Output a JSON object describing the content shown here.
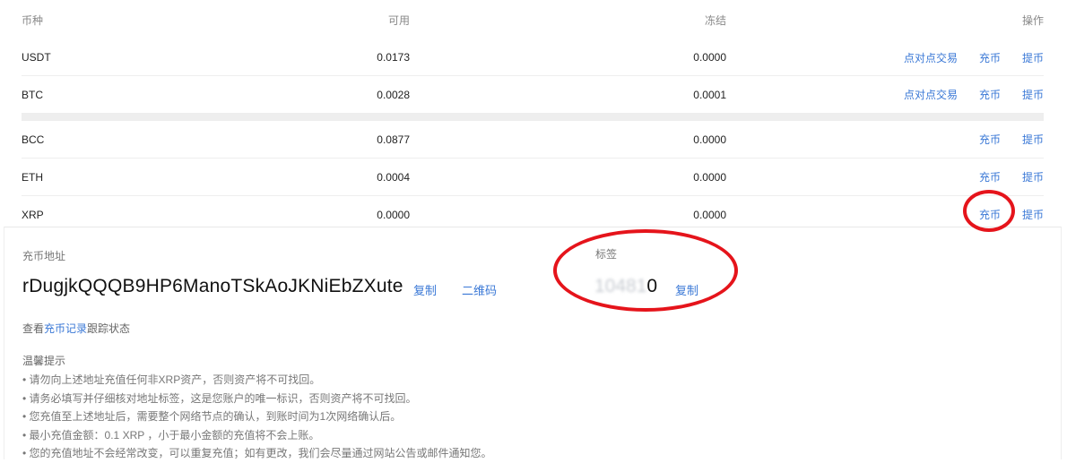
{
  "table": {
    "headers": {
      "currency": "币种",
      "available": "可用",
      "frozen": "冻结",
      "actions": "操作"
    },
    "rows": [
      {
        "currency": "USDT",
        "available": "0.0173",
        "frozen": "0.0000",
        "p2p": "点对点交易",
        "deposit": "充币",
        "withdraw": "提币"
      },
      {
        "currency": "BTC",
        "available": "0.0028",
        "frozen": "0.0001",
        "p2p": "点对点交易",
        "deposit": "充币",
        "withdraw": "提币"
      },
      {
        "currency": "BCC",
        "available": "0.0877",
        "frozen": "0.0000",
        "deposit": "充币",
        "withdraw": "提币"
      },
      {
        "currency": "ETH",
        "available": "0.0004",
        "frozen": "0.0000",
        "deposit": "充币",
        "withdraw": "提币"
      },
      {
        "currency": "XRP",
        "available": "0.0000",
        "frozen": "0.0000",
        "deposit": "充币",
        "withdraw": "提币"
      }
    ]
  },
  "deposit_panel": {
    "address_label": "充币地址",
    "address": "rDugjkQQQB9HP6ManoTSkAoJKNiEbZXute",
    "copy_label": "复制",
    "qrcode_label": "二维码",
    "tag_label": "标签",
    "tag_visible_prefix": "104",
    "tag_blurred_middle": "81",
    "tag_visible_suffix": "0",
    "tag_copy_label": "复制",
    "trace_prefix": "查看",
    "trace_link": "充币记录",
    "trace_suffix": "跟踪状态",
    "tips_title": "温馨提示",
    "tips": [
      "请勿向上述地址充值任何非XRP资产，否则资产将不可找回。",
      "请务必填写并仔细核对地址标签，这是您账户的唯一标识，否则资产将不可找回。",
      "您充值至上述地址后，需要整个网络节点的确认，到账时间为1次网络确认后。",
      "最小充值金额：0.1 XRP ，小于最小金额的充值将不会上账。",
      "您的充值地址不会经常改变，可以重复充值；如有更改，我们会尽量通过网站公告或邮件通知您。"
    ]
  },
  "colors": {
    "link": "#3a78d6",
    "annotation": "#e5141b"
  }
}
